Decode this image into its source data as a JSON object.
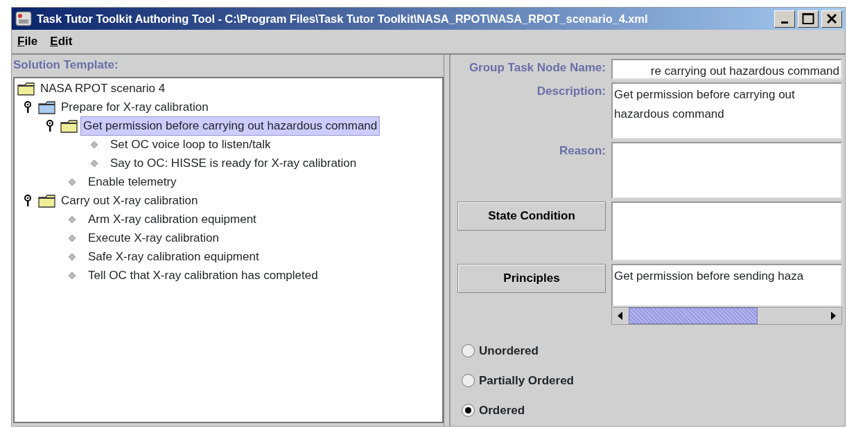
{
  "window": {
    "title": "Task Tutor Toolkit Authoring Tool - C:\\Program Files\\Task Tutor Toolkit\\NASA_RPOT\\NASA_RPOT_scenario_4.xml"
  },
  "menu": [
    {
      "label": "File"
    },
    {
      "label": "Edit"
    }
  ],
  "solution_template": {
    "heading": "Solution Template:",
    "tree": [
      {
        "kind": "group",
        "label": "NASA RPOT scenario 4",
        "color": "#eeee99",
        "selected": false,
        "children": [
          {
            "kind": "group",
            "label": "Prepare for X-ray calibration",
            "color": "#aaccee",
            "expanded": true,
            "selected": false,
            "children": [
              {
                "kind": "group",
                "label": "Get permission before carrying out hazardous command",
                "color": "#eeee99",
                "expanded": true,
                "selected": true,
                "children": [
                  {
                    "kind": "step",
                    "label": "Set OC voice loop to listen/talk",
                    "selected": false
                  },
                  {
                    "kind": "step",
                    "label": "Say to OC: HISSE is ready for X-ray calibration",
                    "selected": false
                  }
                ]
              },
              {
                "kind": "step",
                "label": "Enable telemetry",
                "selected": false
              }
            ]
          },
          {
            "kind": "group",
            "label": "Carry out X-ray calibration",
            "color": "#eeee99",
            "expanded": true,
            "selected": false,
            "children": [
              {
                "kind": "step",
                "label": "Arm X-ray calibration equipment",
                "selected": false
              },
              {
                "kind": "step",
                "label": "Execute X-ray calibration",
                "selected": false
              },
              {
                "kind": "step",
                "label": "Safe X-ray calibration equipment",
                "selected": false
              },
              {
                "kind": "step",
                "label": "Tell OC that X-ray calibration has completed",
                "selected": false
              }
            ]
          }
        ]
      }
    ]
  },
  "details": {
    "fields": [
      {
        "kind": "label",
        "label": "Group Task Node Name:",
        "value": "re carrying out hazardous command",
        "multiline": false
      },
      {
        "kind": "label",
        "label": "Description:",
        "value": "Get permission before carrying out hazardous command",
        "multiline": true
      },
      {
        "kind": "label",
        "label": "Reason:",
        "multiline": true
      },
      {
        "kind": "button",
        "label": "State Condition",
        "multiline": true
      },
      {
        "kind": "button",
        "label": "Principles",
        "value": "Get permission before sending haza",
        "multiline": true,
        "hscroll": true
      }
    ],
    "ordering": [
      {
        "label": "Unordered",
        "selected": false
      },
      {
        "label": "Partially Ordered",
        "selected": false
      },
      {
        "label": "Ordered",
        "selected": true
      }
    ]
  }
}
